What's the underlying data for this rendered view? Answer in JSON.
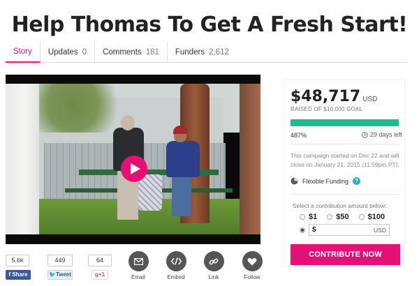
{
  "page": {
    "title": "Help Thomas To Get A Fresh Start!"
  },
  "tabs": [
    {
      "label": "Story",
      "count": ""
    },
    {
      "label": "Updates",
      "count": "0"
    },
    {
      "label": "Comments",
      "count": "181"
    },
    {
      "label": "Funders",
      "count": "2,612"
    }
  ],
  "share": {
    "facebook": {
      "count": "5.6k",
      "label": "Share"
    },
    "twitter": {
      "count": "449",
      "label": "Tweet"
    },
    "google": {
      "count": "64",
      "label": "g+1"
    },
    "actions": [
      {
        "label": "Email",
        "icon": "envelope-icon"
      },
      {
        "label": "Embed",
        "icon": "code-icon"
      },
      {
        "label": "Link",
        "icon": "link-icon"
      },
      {
        "label": "Follow",
        "icon": "heart-icon"
      }
    ]
  },
  "campaign": {
    "amount": "$48,717",
    "currency": "USD",
    "raised_of": "RAISED OF $10,000 GOAL",
    "percent_label": "487%",
    "progress_fraction": 1.0,
    "days_left": "29 days left",
    "started_text": "This campaign started on Dec 22 and will close on January 21, 2015 (11:59pm PT).",
    "funding_type": "Flexible Funding",
    "select_label": "Select a contribution amount below:",
    "amounts": [
      "$1",
      "$50",
      "$100"
    ],
    "custom_prefix": "$",
    "custom_currency": "USD",
    "contribute_label": "CONTRIBUTE NOW"
  },
  "colors": {
    "accent": "#e51075",
    "progress": "#1fbb8f",
    "facebook": "#3b5998"
  }
}
